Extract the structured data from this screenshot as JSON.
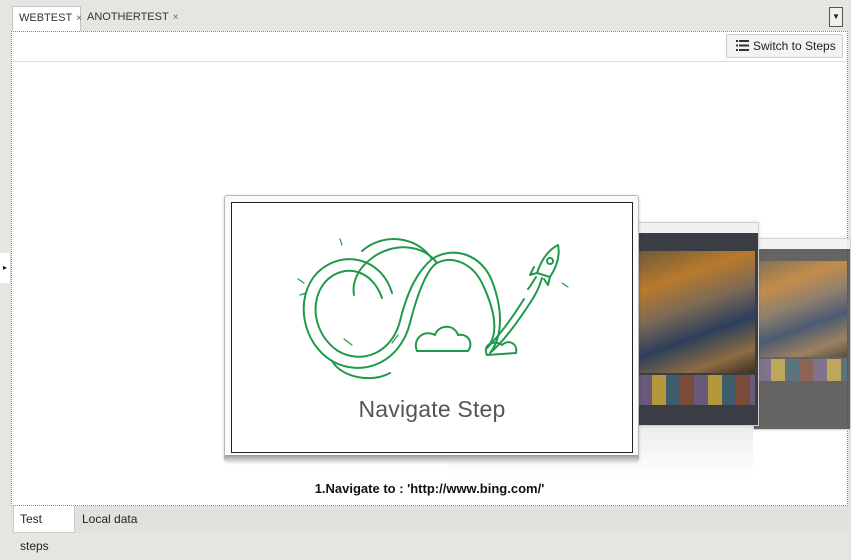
{
  "tabs": [
    {
      "label": "WEBTEST",
      "close": "×"
    },
    {
      "label": "ANOTHERTEST",
      "close": "×"
    }
  ],
  "tab_menu_glyph": "▼",
  "toolbar": {
    "switch_label": "Switch to Steps",
    "switch_icon": "list-icon"
  },
  "side_toggle_glyph": "▸",
  "step": {
    "title": "Navigate Step",
    "caption": "1.Navigate to : 'http://www.bing.com/'"
  },
  "bottom_tabs": [
    {
      "label": "Test steps"
    },
    {
      "label": "Local data"
    }
  ],
  "colors": {
    "illustration": "#1f9a4a",
    "accent": "#2d2d2d"
  }
}
